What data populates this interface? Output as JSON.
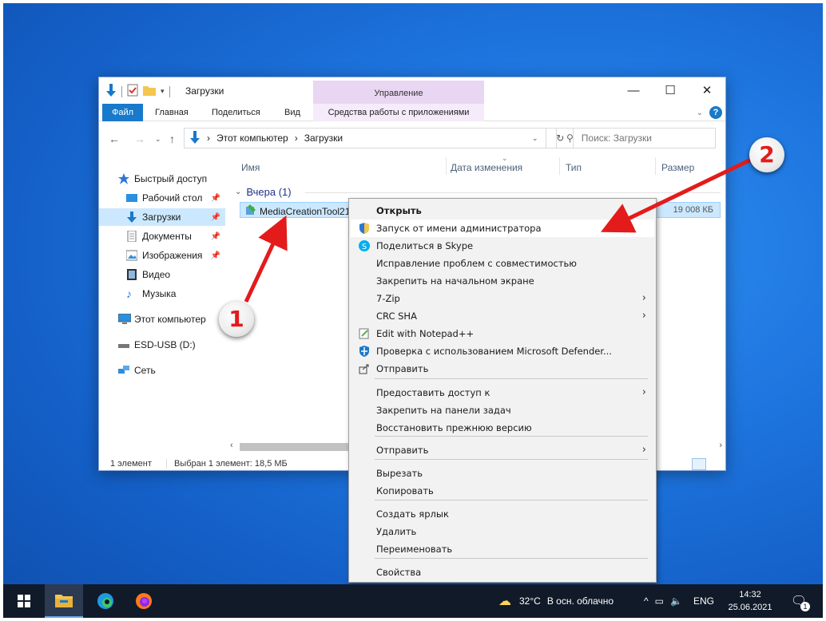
{
  "window": {
    "title": "Загрузки",
    "manage_label": "Управление",
    "controls": {
      "minimize": "—",
      "maximize": "☐",
      "close": "✕"
    }
  },
  "ribbon": {
    "tabs": [
      "Файл",
      "Главная",
      "Поделиться",
      "Вид",
      "Средства работы с приложениями"
    ]
  },
  "navigation": {
    "path": [
      "Этот компьютер",
      "Загрузки"
    ],
    "search_placeholder": "Поиск: Загрузки"
  },
  "sidebar": {
    "items": [
      {
        "label": "Быстрый доступ",
        "icon": "star-icon"
      },
      {
        "label": "Рабочий стол",
        "icon": "desktop-icon",
        "pinned": true
      },
      {
        "label": "Загрузки",
        "icon": "download-icon",
        "pinned": true,
        "selected": true
      },
      {
        "label": "Документы",
        "icon": "document-icon",
        "pinned": true
      },
      {
        "label": "Изображения",
        "icon": "pictures-icon",
        "pinned": true
      },
      {
        "label": "Видео",
        "icon": "video-icon"
      },
      {
        "label": "Музыка",
        "icon": "music-icon"
      },
      {
        "label": "Этот компьютер",
        "icon": "computer-icon"
      },
      {
        "label": "ESD-USB (D:)",
        "icon": "usb-drive-icon"
      },
      {
        "label": "Сеть",
        "icon": "network-icon"
      }
    ]
  },
  "content": {
    "columns": [
      "Имя",
      "Дата изменения",
      "Тип",
      "Размер"
    ],
    "group_label": "Вчера (1)",
    "file": {
      "name": "MediaCreationTool21",
      "size": "19 008 КБ"
    }
  },
  "status": {
    "count": "1 элемент",
    "selection": "Выбран 1 элемент: 18,5 МБ"
  },
  "context_menu": {
    "items": [
      {
        "label": "Открыть",
        "bold": true
      },
      {
        "label": "Запуск от имени администратора",
        "icon": "shield-icon",
        "highlighted": true
      },
      {
        "label": "Поделиться в Skype",
        "icon": "skype-icon"
      },
      {
        "label": "Исправление проблем с совместимостью"
      },
      {
        "label": "Закрепить на начальном экране"
      },
      {
        "label": "7-Zip",
        "submenu": true
      },
      {
        "label": "CRC SHA",
        "submenu": true
      },
      {
        "label": "Edit with Notepad++",
        "icon": "notepad-icon"
      },
      {
        "label": "Проверка с использованием Microsoft Defender...",
        "icon": "defender-icon"
      },
      {
        "label": "Отправить",
        "icon": "share-icon"
      },
      {
        "label": "Предоставить доступ к",
        "submenu": true
      },
      {
        "label": "Закрепить на панели задач"
      },
      {
        "label": "Восстановить прежнюю версию"
      },
      {
        "label": "Отправить",
        "submenu": true
      },
      {
        "label": "Вырезать"
      },
      {
        "label": "Копировать"
      },
      {
        "label": "Создать ярлык"
      },
      {
        "label": "Удалить"
      },
      {
        "label": "Переименовать"
      },
      {
        "label": "Свойства"
      }
    ],
    "submenu_arrow": "›"
  },
  "annotations": {
    "badge_1": "1",
    "badge_2": "2"
  },
  "taskbar": {
    "weather": "32°C",
    "weather_desc": "В осн. облачно",
    "language": "ENG",
    "time": "14:32",
    "date": "25.06.2021",
    "notification_count": "1"
  },
  "colors": {
    "accent": "#1979ca",
    "selection": "#cce8ff",
    "manage_tab": "#e9d6f2",
    "arrow_red": "#e31b1b",
    "taskbar": "#111a29"
  }
}
